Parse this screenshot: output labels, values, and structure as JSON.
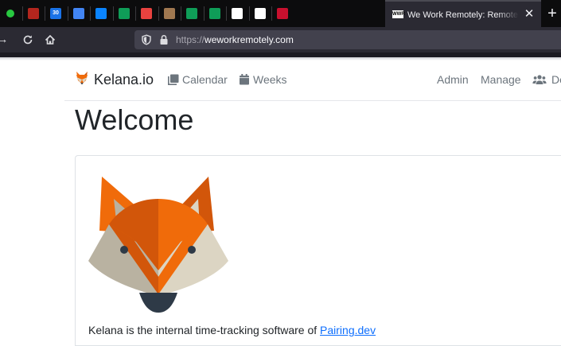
{
  "browser": {
    "pinned_tabs": [
      {
        "name": "tab-green-dot",
        "color": "#28c840"
      },
      {
        "name": "tab-app-red",
        "color": "#b3261e"
      },
      {
        "name": "tab-calendar",
        "color": "#1a73e8",
        "text": "30"
      },
      {
        "name": "tab-docs",
        "color": "#4285f4"
      },
      {
        "name": "tab-app-blue",
        "color": "#0a84ff"
      },
      {
        "name": "tab-sheets",
        "color": "#0f9d58"
      },
      {
        "name": "tab-app-figma",
        "color": "#e8423f"
      },
      {
        "name": "tab-app-photo",
        "color": "#a07850"
      },
      {
        "name": "tab-sheets-2",
        "color": "#0f9d58"
      },
      {
        "name": "tab-sheets-3",
        "color": "#0f9d58"
      },
      {
        "name": "tab-github",
        "color": "#ffffff"
      },
      {
        "name": "tab-github-2",
        "color": "#ffffff"
      },
      {
        "name": "tab-app-v",
        "color": "#c8102e"
      }
    ],
    "active_tab": {
      "favicon_text": "WWR",
      "title": "We Work Remotely: Remote jobs in design, programming, marketing and more"
    },
    "url_scheme": "https://",
    "url_host": "weworkremotely.com"
  },
  "navbar": {
    "brand": "Kelana.io",
    "links": [
      {
        "label": "Calendar",
        "icon": "calendar-icon"
      },
      {
        "label": "Weeks",
        "icon": "weeks-icon"
      }
    ],
    "right_links": [
      "Admin",
      "Manage",
      "De"
    ]
  },
  "page": {
    "heading": "Welcome",
    "intro_prefix": "Kelana is the internal time-tracking software of ",
    "intro_link": "Pairing.dev"
  },
  "colors": {
    "fox_orange": "#f06b0a",
    "fox_dark_orange": "#d2560a",
    "fox_cream": "#dcd5c3",
    "fox_grey": "#b9b2a1",
    "fox_nose": "#2e3a47"
  }
}
